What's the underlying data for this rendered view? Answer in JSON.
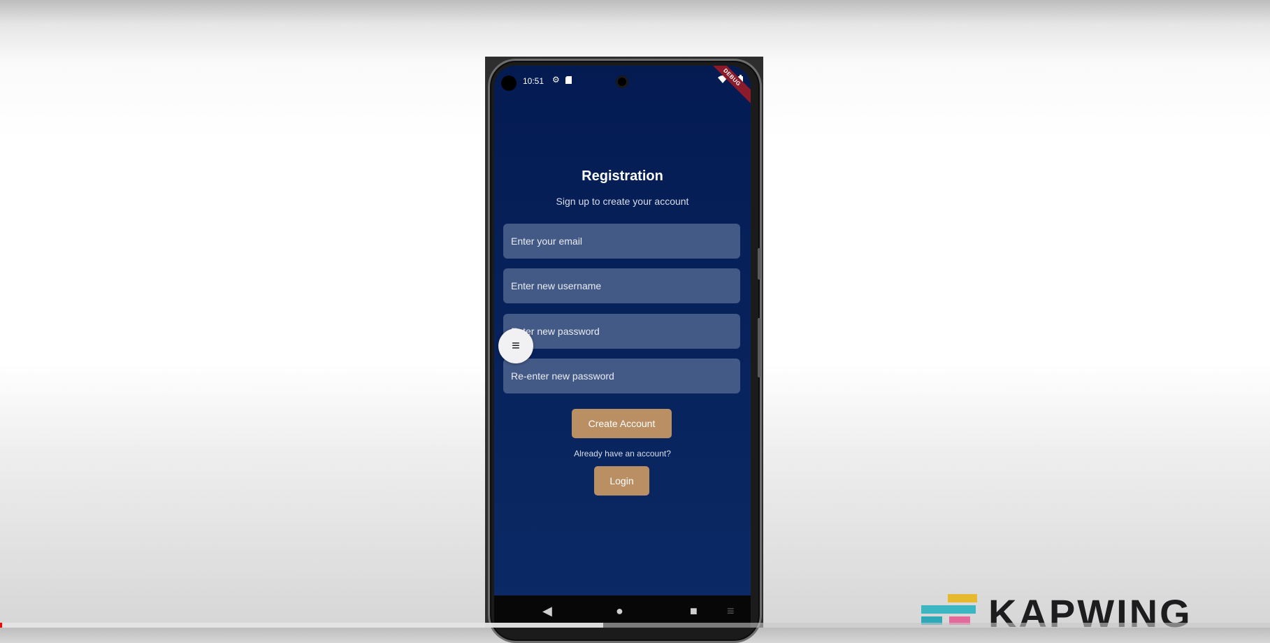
{
  "status_bar": {
    "time": "10:51",
    "icons": [
      "gear-icon",
      "sd-card-icon",
      "wifi-icon",
      "battery-icon"
    ],
    "debug_banner": "DEBUG"
  },
  "registration": {
    "title": "Registration",
    "subtitle": "Sign up to create your account",
    "fields": {
      "email_placeholder": "Enter your email",
      "username_placeholder": "Enter new username",
      "password_placeholder": "Enter new password",
      "confirm_placeholder": "Re-enter new password"
    },
    "create_account_label": "Create Account",
    "login_prompt": "Already have an account?",
    "login_label": "Login"
  },
  "navigation": {
    "back": "◀",
    "home": "●",
    "recents": "■",
    "menu": "≡"
  },
  "floating_menu_icon": "≡",
  "watermark": {
    "text": "KAPWING"
  },
  "video_progress": {
    "played_fraction": 0.001,
    "buffered_fraction": 0.475
  },
  "colors": {
    "screen_background": "#041b52",
    "field_background": "#445a86",
    "button_accent": "#b98f63",
    "debug_banner": "#8b1a2b"
  }
}
